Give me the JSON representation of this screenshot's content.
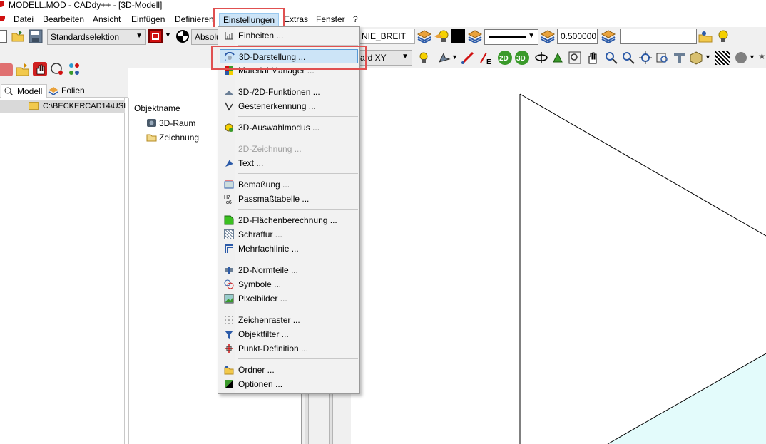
{
  "window": {
    "title": "MODELL.MOD  -  CADdy++ - [3D-Modell]"
  },
  "menubar": {
    "items": [
      "Datei",
      "Bearbeiten",
      "Ansicht",
      "Einfügen",
      "Definieren",
      "Einstellungen",
      "Extras",
      "Fenster",
      "?"
    ],
    "active": "Einstellungen"
  },
  "toolbar": {
    "selection_mode": "Standardselektion",
    "absolute_label": "Absolu",
    "line_type_value": "NIE_BREIT",
    "plane_value": "ard XY",
    "line_width_value": "0.500000",
    "layer_value": ""
  },
  "tabs": [
    {
      "label": "Modell",
      "active": true
    },
    {
      "label": "Folien",
      "active": false
    }
  ],
  "tree": {
    "path": "C:\\BECKERCAD14\\USI"
  },
  "object_panel": {
    "header": "Objektname",
    "items": [
      "3D-Raum",
      "Zeichnung"
    ]
  },
  "dropdown": {
    "items": [
      {
        "label": "Einheiten ...",
        "icon": "units-icon"
      },
      {
        "label": "3D-Darstellung ...",
        "icon": "3d-display-icon",
        "selected": true
      },
      {
        "label": "Material Manager ...",
        "icon": "material-icon"
      },
      {
        "label": "3D-/2D-Funktionen ...",
        "icon": "functions-icon"
      },
      {
        "label": "Gestenerkennung ...",
        "icon": "gesture-icon"
      },
      {
        "label": "3D-Auswahlmodus ...",
        "icon": "selection-mode-icon"
      },
      {
        "label": "2D-Zeichnung ...",
        "icon": "",
        "disabled": true
      },
      {
        "label": "Text ...",
        "icon": "text-icon"
      },
      {
        "label": "Bemaßung ...",
        "icon": "dimension-icon"
      },
      {
        "label": "Passmaßtabelle ...",
        "icon": "fit-table-icon"
      },
      {
        "label": "2D-Flächenberechnung ...",
        "icon": "area-calc-icon"
      },
      {
        "label": "Schraffur ...",
        "icon": "hatch-icon"
      },
      {
        "label": "Mehrfachlinie ...",
        "icon": "multiline-icon"
      },
      {
        "label": "2D-Normteile ...",
        "icon": "standard-parts-icon"
      },
      {
        "label": "Symbole ...",
        "icon": "symbols-icon"
      },
      {
        "label": "Pixelbilder ...",
        "icon": "pixel-images-icon"
      },
      {
        "label": "Zeichenraster ...",
        "icon": "grid-icon"
      },
      {
        "label": "Objektfilter ...",
        "icon": "object-filter-icon"
      },
      {
        "label": "Punkt-Definition ...",
        "icon": "point-def-icon"
      },
      {
        "label": "Ordner ...",
        "icon": "folder-icon"
      },
      {
        "label": "Optionen ...",
        "icon": "options-icon"
      }
    ]
  },
  "colors": {
    "highlight": "#e05050",
    "selection": "#cce4f7",
    "accent_cyan": "#e3fbfb"
  }
}
